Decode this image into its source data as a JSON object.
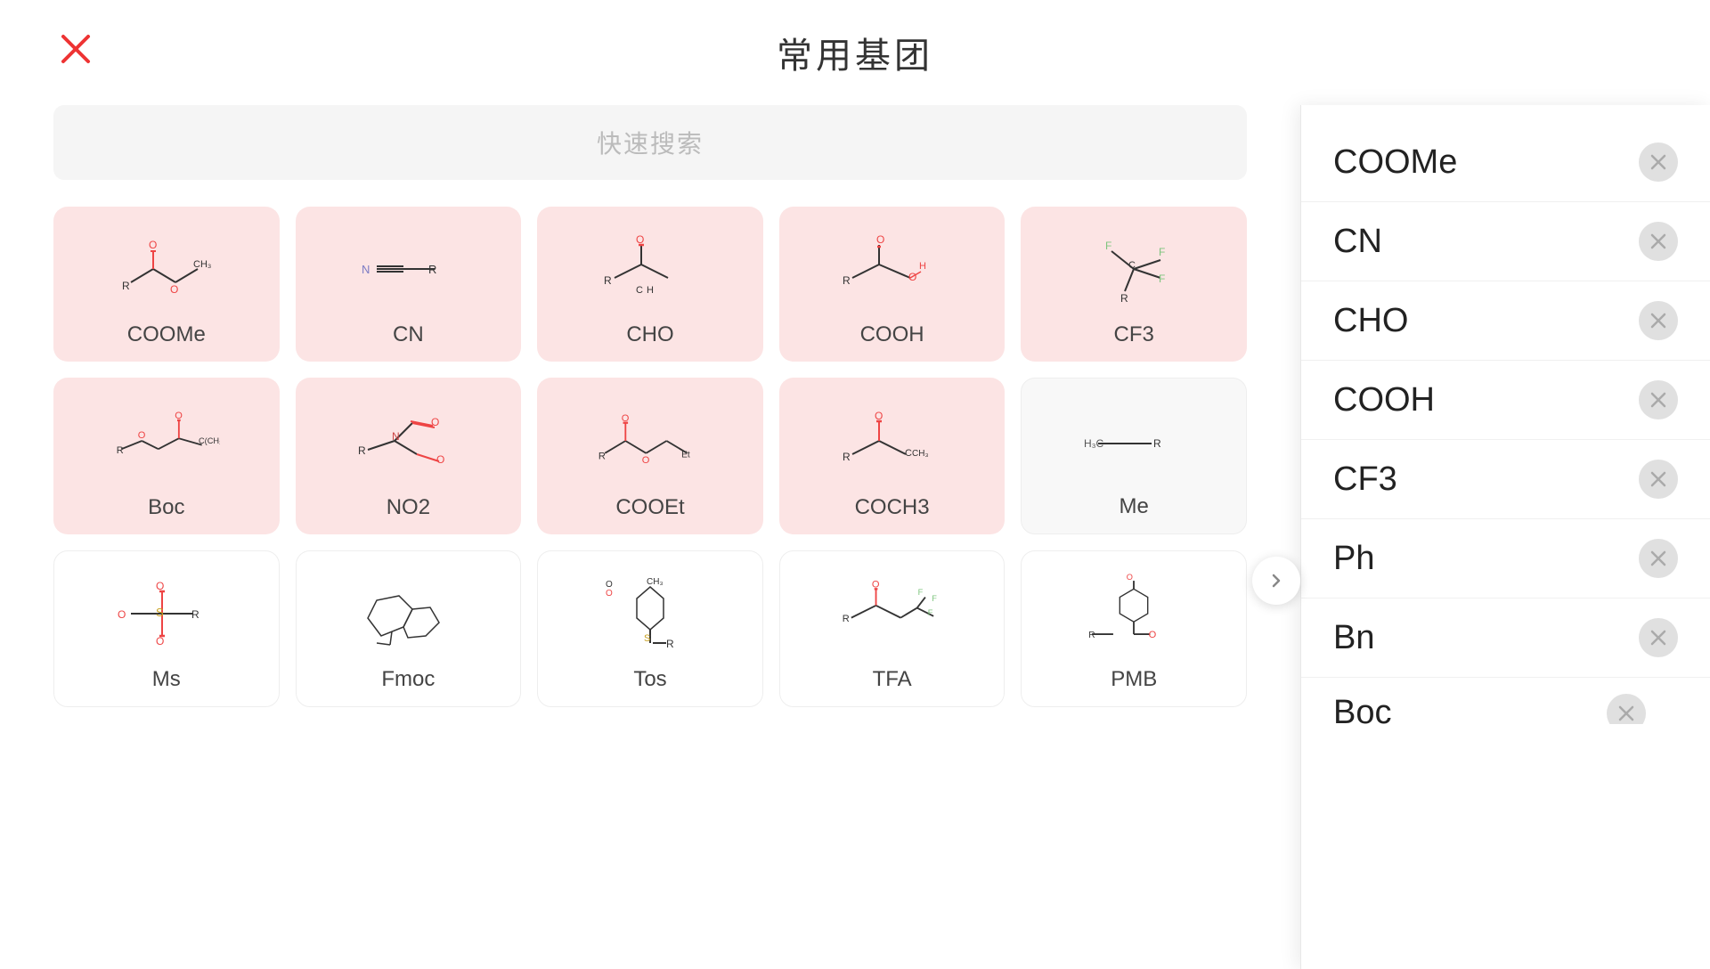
{
  "header": {
    "title": "常用基团",
    "close_label": "close"
  },
  "search": {
    "placeholder": "快速搜索"
  },
  "grid_items": [
    {
      "id": "coome",
      "label": "COOMe",
      "bg": "pink"
    },
    {
      "id": "cn",
      "label": "CN",
      "bg": "pink"
    },
    {
      "id": "cho",
      "label": "CHO",
      "bg": "pink"
    },
    {
      "id": "cooh",
      "label": "COOH",
      "bg": "pink"
    },
    {
      "id": "cf3",
      "label": "CF3",
      "bg": "pink-light"
    },
    {
      "id": "boc",
      "label": "Boc",
      "bg": "pink"
    },
    {
      "id": "no2",
      "label": "NO2",
      "bg": "pink"
    },
    {
      "id": "cooet",
      "label": "COOEt",
      "bg": "pink"
    },
    {
      "id": "coch3",
      "label": "COCH3",
      "bg": "pink"
    },
    {
      "id": "me",
      "label": "Me",
      "bg": "white"
    },
    {
      "id": "ms",
      "label": "Ms",
      "bg": "white"
    },
    {
      "id": "fmoc",
      "label": "Fmoc",
      "bg": "white"
    },
    {
      "id": "tos",
      "label": "Tos",
      "bg": "white"
    },
    {
      "id": "tfa",
      "label": "TFA",
      "bg": "white"
    },
    {
      "id": "pmb",
      "label": "PMB",
      "bg": "white"
    }
  ],
  "sidebar_items": [
    {
      "label": "COOMe"
    },
    {
      "label": "CN"
    },
    {
      "label": "CHO"
    },
    {
      "label": "COOH"
    },
    {
      "label": "CF3"
    },
    {
      "label": "Ph"
    },
    {
      "label": "Bn"
    },
    {
      "label": "Boc"
    }
  ]
}
